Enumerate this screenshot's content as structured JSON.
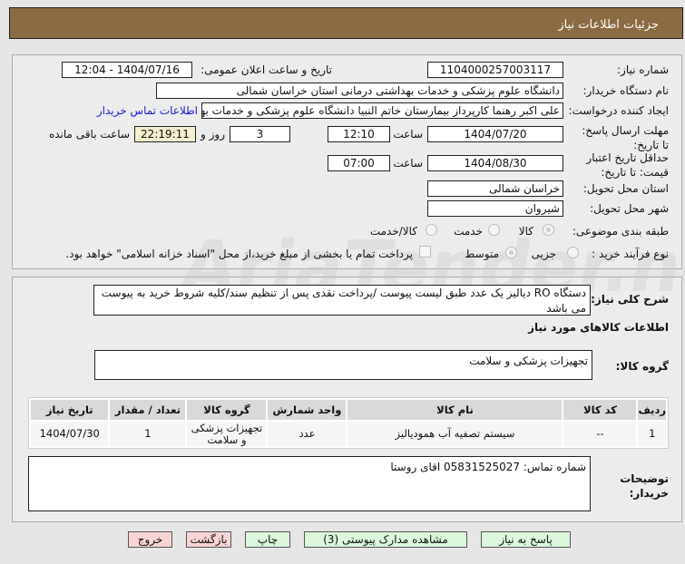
{
  "header": {
    "title": "جزئیات اطلاعات نیاز"
  },
  "form": {
    "need_number_label": "شماره نیاز:",
    "need_number": "1104000257003117",
    "announce_label": "تاریخ و ساعت اعلان عمومی:",
    "announce_value": "1404/07/16 - 12:04",
    "buyer_label": "نام دستگاه خریدار:",
    "buyer": "دانشگاه علوم پزشکی و خدمات بهداشتی درمانی استان خراسان شمالی",
    "creator_label": "ایجاد کننده درخواست:",
    "creator": "علی اکبر رهنما کارپرداز بیمارستان خاتم النبیا دانشگاه علوم پزشکی و خدمات بهداشتی",
    "contact_link": "اطلاعات تماس خریدار",
    "deadline_label": "مهلت ارسال پاسخ: تا تاریخ:",
    "deadline_date": "1404/07/20",
    "time_label": "ساعت",
    "deadline_time": "12:10",
    "days": "3",
    "days_label": "روز و",
    "remaining": "22:19:11",
    "remaining_label": "ساعت باقی مانده",
    "validity_label": "حداقل تاریخ اعتبار قیمت: تا تاریخ:",
    "validity_date": "1404/08/30",
    "validity_time": "07:00",
    "province_label": "استان محل تحویل:",
    "province": "خراسان شمالی",
    "city_label": "شهر محل تحویل:",
    "city": "شیروان",
    "category_label": "طبقه بندی موضوعی:",
    "category_options": [
      "کالا",
      "خدمت",
      "کالا/خدمت"
    ],
    "category_selected": "کالا",
    "process_label": "نوع فرآیند خرید :",
    "process_options": [
      "جزیی",
      "متوسط"
    ],
    "process_selected": "متوسط",
    "payment_text": "پرداخت تمام یا بخشی از مبلغ خرید،از محل \"اسناد خزانه اسلامی\" خواهد بود."
  },
  "details": {
    "description_label": "شرح کلی نیاز:",
    "description": "دستگاه RO دیالیز یک عدد طبق لیست پیوست /پرداخت نقدی پس از تنظیم سند/کلیه شروط خرید به پیوست می باشد",
    "goods_info_title": "اطلاعات کالاهای مورد نیاز",
    "group_label": "گروه کالا:",
    "group": "تجهیزات پزشکی و سلامت",
    "table": {
      "headers": [
        "ردیف",
        "کد کالا",
        "نام کالا",
        "واحد شمارش",
        "گروه کالا",
        "تعداد / مقدار",
        "تاریخ نیاز"
      ],
      "rows": [
        [
          "1",
          "--",
          "سیستم تصفیه آب همودیالیز",
          "عدد",
          "تجهیزات پزشکی و سلامت",
          "1",
          "1404/07/30"
        ]
      ]
    },
    "notes_label": "توضیحات خریدار:",
    "notes": "شماره تماس: 05831525027 اقای روستا"
  },
  "buttons": {
    "reply": "پاسخ به نیاز",
    "attachments": "مشاهده مدارک پیوستی (3)",
    "print": "چاپ",
    "back": "بازگشت",
    "exit": "خروج"
  },
  "watermark": "AriaTender.net"
}
